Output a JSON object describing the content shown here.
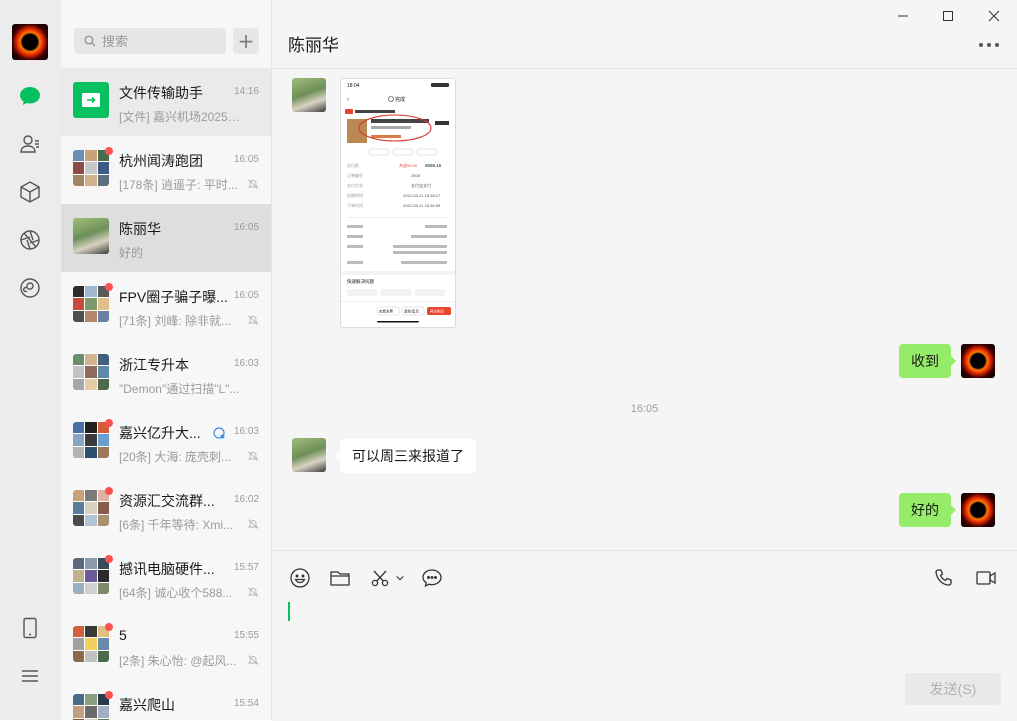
{
  "colors": {
    "accent": "#07c160",
    "unread_dot": "#fa5151",
    "bubble_out": "#95ec69",
    "bubble_in": "#ffffff"
  },
  "rail": {
    "icons": [
      "chat-icon",
      "contacts-icon",
      "cube-icon",
      "moments-icon",
      "mini-program-icon",
      "phone-icon",
      "menu-icon"
    ]
  },
  "search": {
    "placeholder": "搜索",
    "add_label": "+"
  },
  "conversations": [
    {
      "name": "文件传输助手",
      "time": "14:16",
      "preview": "[文件] 嘉兴机场2025年...",
      "muted": false,
      "unread": false
    },
    {
      "name": "杭州闻涛跑团",
      "time": "16:05",
      "preview": "[178条] 逍遥子: 平时...",
      "muted": true,
      "unread": true
    },
    {
      "name": "陈丽华",
      "time": "16:05",
      "preview": "好的",
      "muted": false,
      "unread": false
    },
    {
      "name": "FPV圈子骗子曝...",
      "time": "16:05",
      "preview": "[71条] 刘峰: 除非就...",
      "muted": true,
      "unread": true
    },
    {
      "name": "浙江专升本",
      "time": "16:03",
      "preview": "\"Demon\"通过扫描\"L\"...",
      "muted": false,
      "unread": false
    },
    {
      "name": "嘉兴亿升大...",
      "time": "16:03",
      "preview": "[20条] 大海: 庞壳刺...",
      "muted": true,
      "unread": true
    },
    {
      "name": "资源汇交流群...",
      "time": "16:02",
      "preview": "[6条] 千年等待: Xmi...",
      "muted": true,
      "unread": true
    },
    {
      "name": "撼讯电脑硬件...",
      "time": "15:57",
      "preview": "[64条] 诚心收个588...",
      "muted": true,
      "unread": true
    },
    {
      "name": "5",
      "time": "15:55",
      "preview": "[2条] 朱心怡: @起风...",
      "muted": true,
      "unread": true
    },
    {
      "name": "嘉兴爬山",
      "time": "15:54",
      "preview": "",
      "muted": false,
      "unread": true
    }
  ],
  "chat": {
    "title": "陈丽华",
    "time_separator": "16:05",
    "messages": [
      {
        "from": "other",
        "type": "image"
      },
      {
        "from": "me",
        "type": "text",
        "text": "收到"
      },
      {
        "from": "other",
        "type": "text",
        "text": "可以周三来报道了"
      },
      {
        "from": "me",
        "type": "text",
        "text": "好的"
      }
    ],
    "screenshot": {
      "status_time": "18:04",
      "nav_title": "完成",
      "badge": "已付款",
      "price_label": "共退¥0.00",
      "total": "¥698.16",
      "rows": [
        {
          "k": "订单编号",
          "v": "2508"
        },
        {
          "k": "支付方式",
          "v": "支付宝支付"
        },
        {
          "k": "创建时间",
          "v": "2022-08-21 15:38:17"
        },
        {
          "k": "下单时间",
          "v": "2022-08-21 15:38:58"
        }
      ],
      "section": "快速解决问题",
      "bottom_buttons": [
        "查看发票",
        "退款/售后",
        "再次购买"
      ]
    }
  },
  "composer": {
    "send_label": "发送(S)",
    "tools": [
      "emoji-icon",
      "folder-icon",
      "scissors-icon",
      "chat-bubble-icon"
    ],
    "call_tools": [
      "phone-call-icon",
      "video-call-icon"
    ]
  }
}
